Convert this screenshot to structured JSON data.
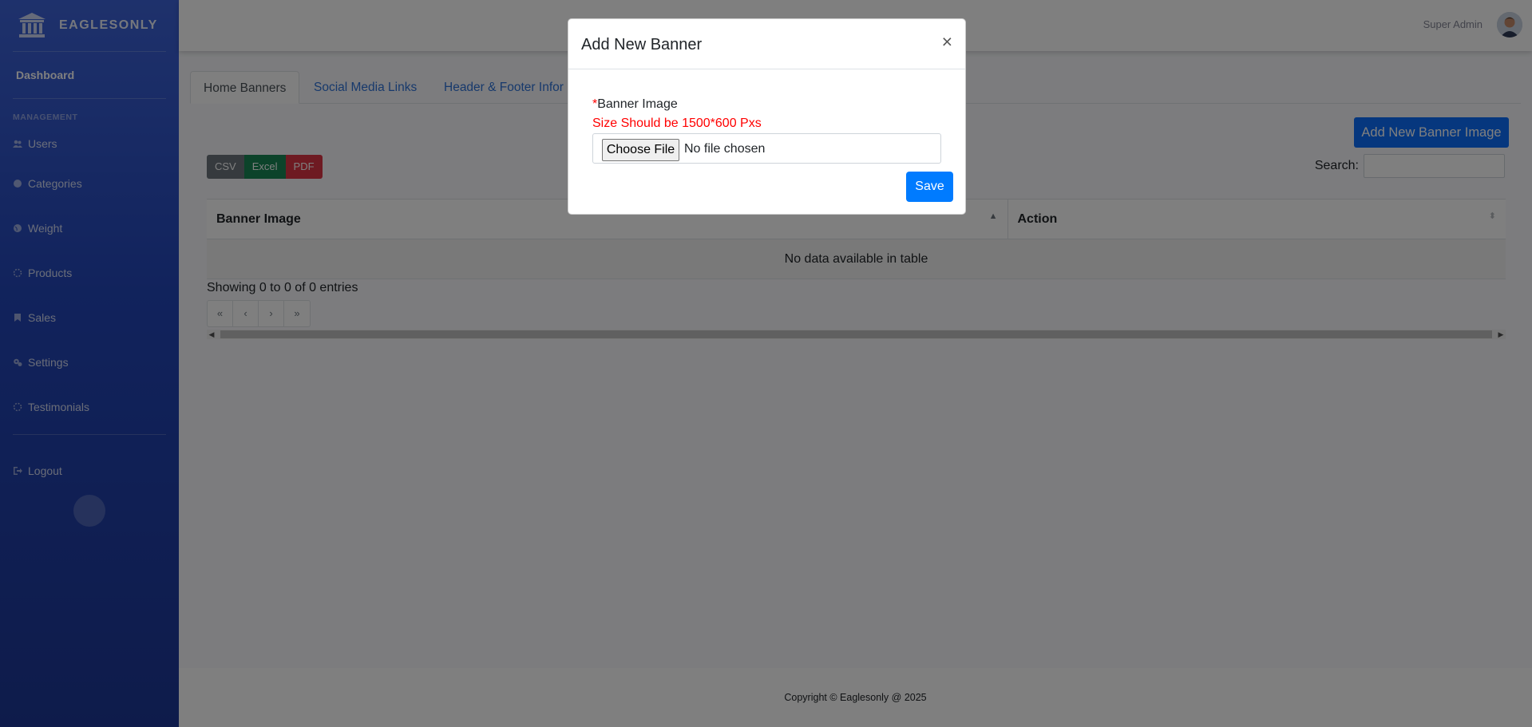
{
  "brand": {
    "name": "EAGLESONLY"
  },
  "sidebar": {
    "dashboard": "Dashboard",
    "heading": "MANAGEMENT",
    "items": [
      {
        "label": "Users",
        "icon": "users-icon"
      },
      {
        "label": "Categories",
        "icon": "circle-icon"
      },
      {
        "label": "Weight",
        "icon": "globe-icon"
      },
      {
        "label": "Products",
        "icon": "spinner-icon"
      },
      {
        "label": "Sales",
        "icon": "bookmark-icon"
      },
      {
        "label": "Settings",
        "icon": "gears-icon"
      },
      {
        "label": "Testimonials",
        "icon": "spinner-icon"
      }
    ],
    "logout": "Logout"
  },
  "topbar": {
    "user_name": "Super Admin"
  },
  "tabs": [
    {
      "label": "Home Banners",
      "active": true
    },
    {
      "label": "Social Media Links",
      "active": false
    },
    {
      "label": "Header & Footer Infor",
      "active": false
    }
  ],
  "toolbar": {
    "add_button": "Add New Banner Image",
    "export": {
      "csv": "CSV",
      "excel": "Excel",
      "pdf": "PDF"
    },
    "search_label": "Search:"
  },
  "table": {
    "columns": [
      "Banner Image",
      "Action"
    ],
    "empty_message": "No data available in table",
    "info": "Showing 0 to 0 of 0 entries"
  },
  "pagination": {
    "first": "«",
    "prev": "‹",
    "next": "›",
    "last": "»"
  },
  "footer": {
    "text": "Copyright © Eaglesonly @ 2025"
  },
  "modal": {
    "title": "Add New Banner",
    "close": "×",
    "required_mark": "*",
    "field_label": "Banner Image",
    "size_hint": "Size Should be 1500*600 Pxs",
    "choose_file": "Choose File",
    "file_status": "No file chosen",
    "save": "Save"
  }
}
